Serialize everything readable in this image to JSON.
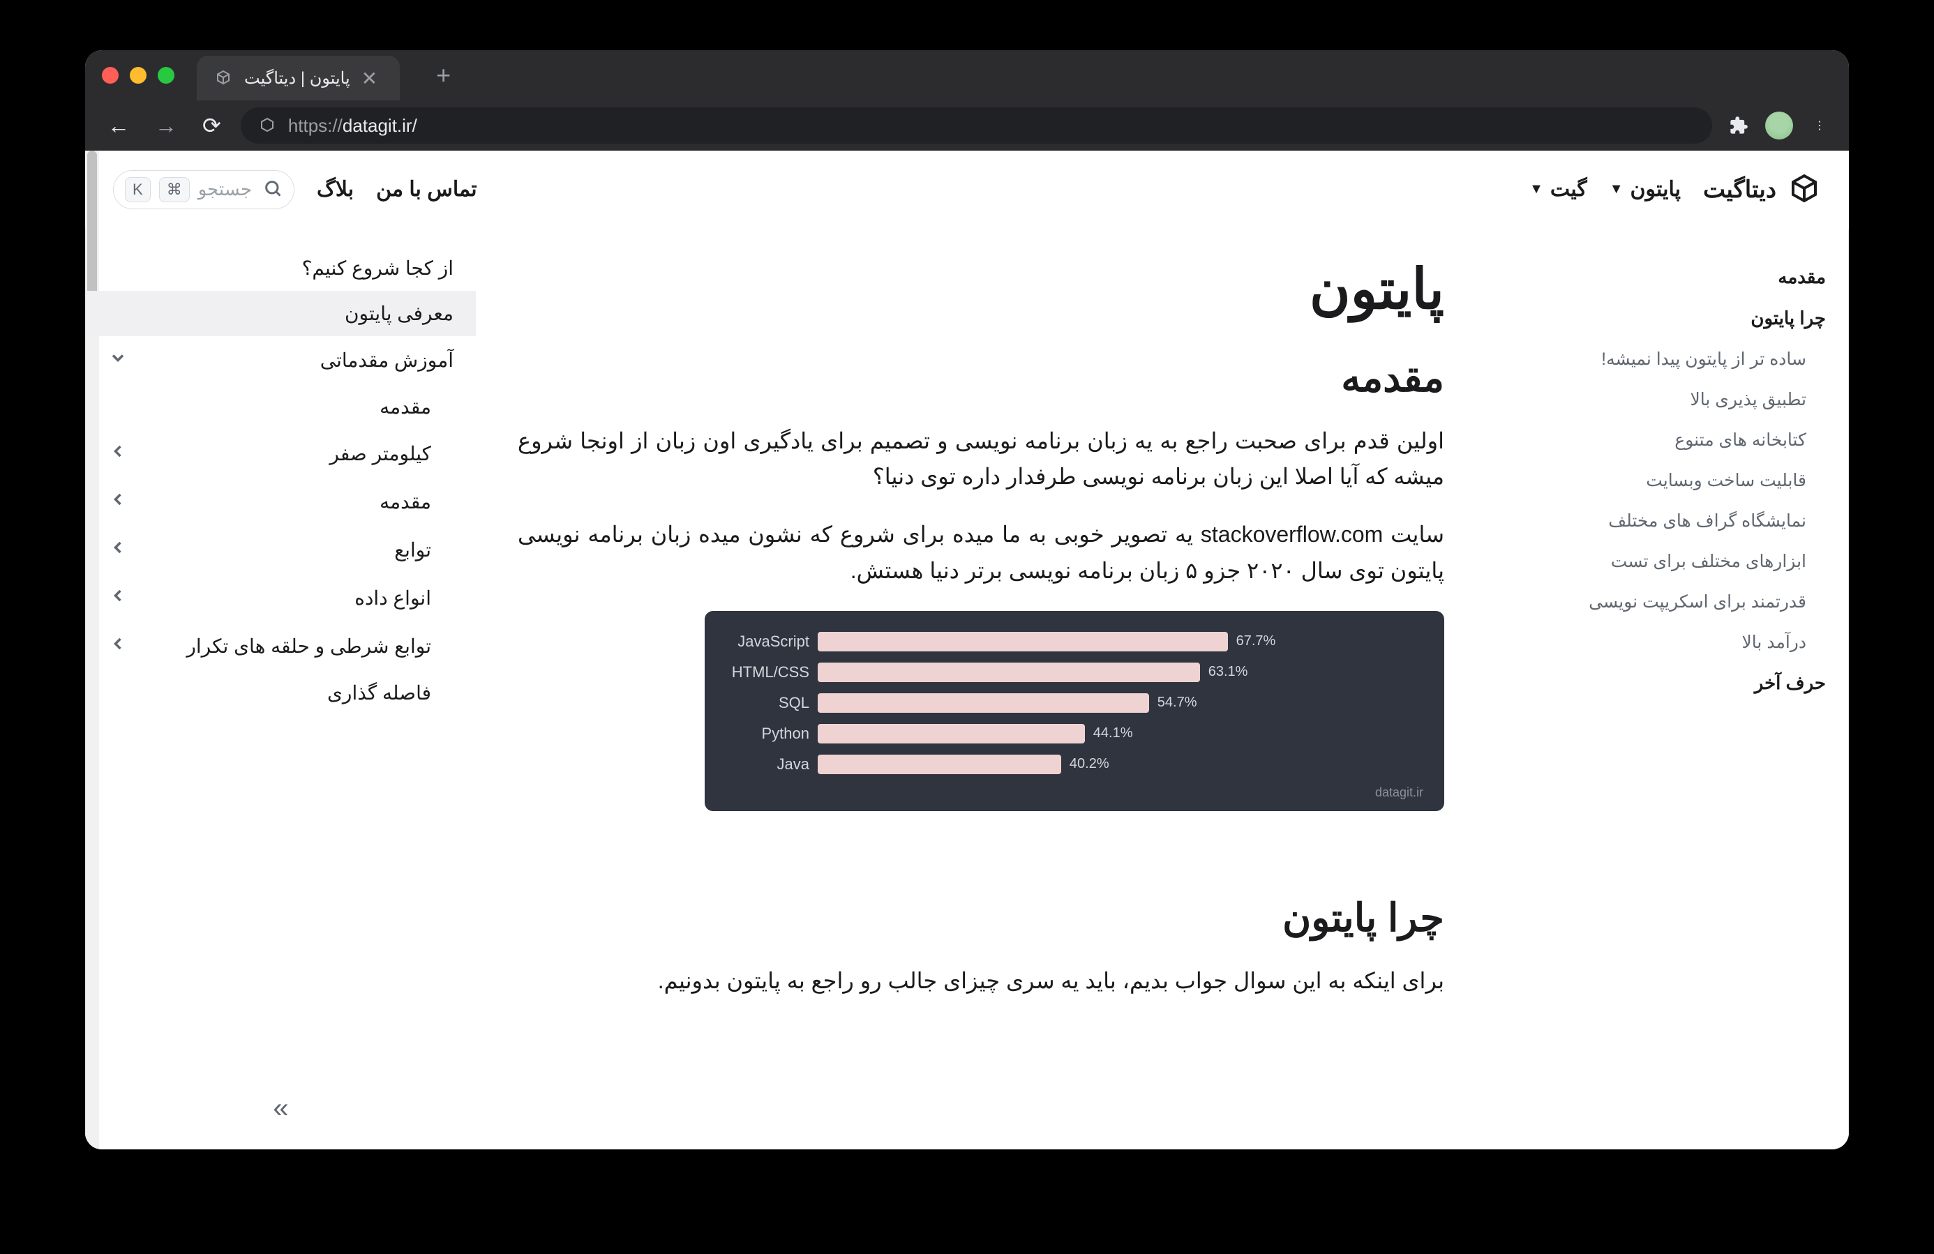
{
  "browser": {
    "tab_title": "پایتون | دیتاگیت",
    "url_proto": "https://",
    "url_rest": "datagit.ir/"
  },
  "header": {
    "brand": "دیتاگیت",
    "nav": [
      {
        "label": "پایتون",
        "dropdown": true
      },
      {
        "label": "گیت",
        "dropdown": true
      }
    ],
    "nav_right": [
      {
        "label": "تماس با من"
      },
      {
        "label": "بلاگ"
      }
    ],
    "search_placeholder": "جستجو",
    "kbd1": "⌘",
    "kbd2": "K"
  },
  "sidebar": {
    "items": [
      {
        "label": "از کجا شروع کنیم؟",
        "indent": 0,
        "chevron": false,
        "active": false
      },
      {
        "label": "معرفی پایتون",
        "indent": 0,
        "chevron": false,
        "active": true
      },
      {
        "label": "آموزش مقدماتی",
        "indent": 0,
        "chevron": "down",
        "active": false
      },
      {
        "label": "مقدمه",
        "indent": 1,
        "chevron": false,
        "active": false
      },
      {
        "label": "کیلومتر صفر",
        "indent": 1,
        "chevron": "left",
        "active": false
      },
      {
        "label": "مقدمه",
        "indent": 1,
        "chevron": "left",
        "active": false
      },
      {
        "label": "توابع",
        "indent": 1,
        "chevron": "left",
        "active": false
      },
      {
        "label": "انواع داده",
        "indent": 1,
        "chevron": "left",
        "active": false
      },
      {
        "label": "توابع شرطی و حلقه های تکرار",
        "indent": 1,
        "chevron": "left",
        "active": false
      },
      {
        "label": "فاصله گذاری",
        "indent": 1,
        "chevron": false,
        "active": false
      }
    ]
  },
  "article": {
    "h1": "پایتون",
    "h2_intro": "مقدمه",
    "p1": "اولین قدم برای صحبت راجع به یه زبان برنامه نویسی و تصمیم برای یادگیری اون زبان از اونجا شروع میشه که آیا اصلا این زبان برنامه نویسی طرفدار داره توی دنیا؟",
    "p2": "سایت stackoverflow.com یه تصویر خوبی به ما میده برای شروع که نشون میده زبان برنامه نویسی پایتون توی سال ۲۰۲۰ جزو ۵ زبان برنامه نویسی برتر دنیا هستش.",
    "h2_why": "چرا پایتون",
    "p3": "برای اینکه به این سوال جواب بدیم، باید یه سری چیزای جالب رو راجع به پایتون بدونیم."
  },
  "toc": {
    "items": [
      {
        "label": "مقدمه",
        "bold": true,
        "sub": false
      },
      {
        "label": "چرا پایتون",
        "bold": true,
        "sub": false
      },
      {
        "label": "ساده تر از پایتون پیدا نمیشه!",
        "bold": false,
        "sub": true
      },
      {
        "label": "تطبیق پذیری بالا",
        "bold": false,
        "sub": true
      },
      {
        "label": "کتابخانه های متنوع",
        "bold": false,
        "sub": true
      },
      {
        "label": "قابلیت ساخت وبسایت",
        "bold": false,
        "sub": true
      },
      {
        "label": "نمایشگاه گراف های مختلف",
        "bold": false,
        "sub": true
      },
      {
        "label": "ابزارهای مختلف برای تست",
        "bold": false,
        "sub": true
      },
      {
        "label": "قدرتمند برای اسکریپت نویسی",
        "bold": false,
        "sub": true
      },
      {
        "label": "درآمد بالا",
        "bold": false,
        "sub": true
      },
      {
        "label": "حرف آخر",
        "bold": true,
        "sub": false
      }
    ]
  },
  "chart_data": {
    "type": "bar",
    "orientation": "horizontal",
    "title": "",
    "footer": "datagit.ir",
    "xlim": [
      0,
      100
    ],
    "categories": [
      "JavaScript",
      "HTML/CSS",
      "SQL",
      "Python",
      "Java"
    ],
    "values": [
      67.7,
      63.1,
      54.7,
      44.1,
      40.2
    ]
  }
}
